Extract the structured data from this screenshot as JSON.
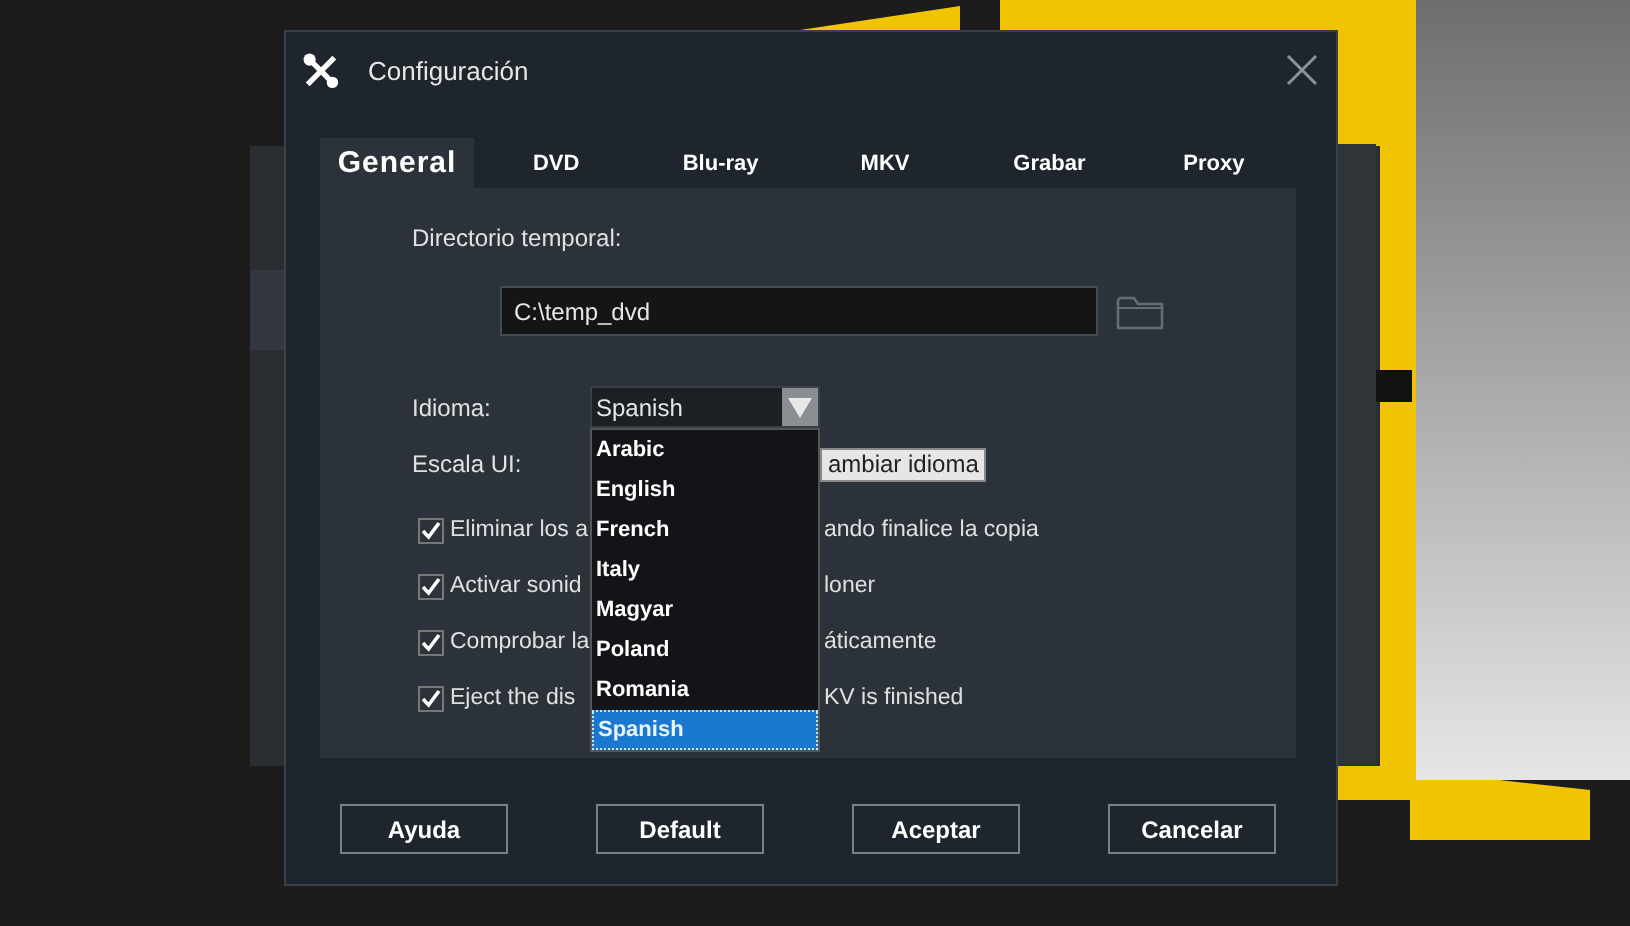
{
  "window": {
    "title": "Configuración"
  },
  "tabs": [
    {
      "label": "General",
      "selected": true
    },
    {
      "label": "DVD",
      "selected": false
    },
    {
      "label": "Blu-ray",
      "selected": false
    },
    {
      "label": "MKV",
      "selected": false
    },
    {
      "label": "Grabar",
      "selected": false
    },
    {
      "label": "Proxy",
      "selected": false
    }
  ],
  "general": {
    "temp_dir_label": "Directorio temporal:",
    "temp_dir_value": "C:\\temp_dvd",
    "language_label": "Idioma:",
    "language_value": "Spanish",
    "language_options": [
      {
        "label": "Arabic",
        "selected": false
      },
      {
        "label": "English",
        "selected": false
      },
      {
        "label": "French",
        "selected": false
      },
      {
        "label": "Italy",
        "selected": false
      },
      {
        "label": "Magyar",
        "selected": false
      },
      {
        "label": "Poland",
        "selected": false
      },
      {
        "label": "Romania",
        "selected": false
      },
      {
        "label": "Spanish",
        "selected": true
      }
    ],
    "ui_scale_label": "Escala UI:",
    "change_language_button": "ambiar idioma",
    "options": [
      {
        "text_before": "Eliminar los a",
        "text_after": "ando finalice la copia",
        "checked": true
      },
      {
        "text_before": "Activar sonid",
        "text_after": "loner",
        "checked": true
      },
      {
        "text_before": "Comprobar la",
        "text_after": "áticamente",
        "checked": true
      },
      {
        "text_before": "Eject the dis",
        "text_after": "KV is finished",
        "checked": true
      }
    ]
  },
  "buttons": [
    {
      "label": "Ayuda"
    },
    {
      "label": "Default"
    },
    {
      "label": "Aceptar"
    },
    {
      "label": "Cancelar"
    }
  ]
}
